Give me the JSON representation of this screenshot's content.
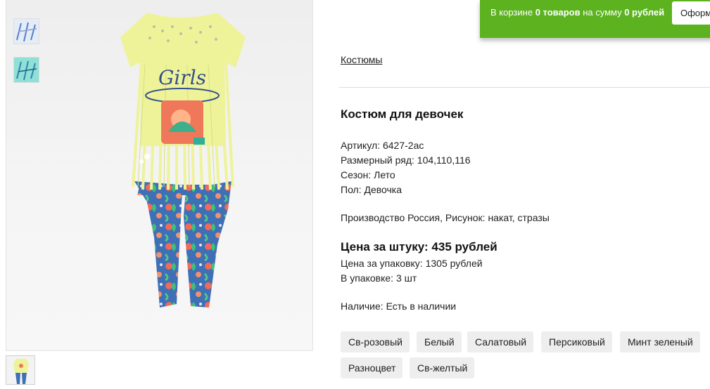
{
  "cart": {
    "prefix": "В корзине ",
    "count": "0 товаров",
    "middle": " на сумму ",
    "sum": "0 рублей",
    "checkout_label": "Оформить"
  },
  "breadcrumb": "Костюмы",
  "product": {
    "title": "Костюм для девочек",
    "props": [
      "Артикул: 6427-2ас",
      "Размерный ряд: 104,110,116",
      "Сезон: Лето",
      "Пол: Девочка"
    ],
    "origin": "Производство Россия, Рисунок: накат, стразы",
    "price_piece": "Цена за штуку: 435 рублей",
    "price_pack": "Цена за упаковку: 1305 рублей",
    "pack_count": "В упаковке: 3 шт",
    "stock": "Наличие: Есть в наличии",
    "print_text": "Girls"
  },
  "colors": [
    "Св-розовый",
    "Белый",
    "Салатовый",
    "Персиковый",
    "Минт зеленый",
    "Разноцвет",
    "Св-желтый"
  ],
  "theme": {
    "cart_green": "#5cb31f",
    "chip_bg": "#eeeeee",
    "shirt": "#eef39a",
    "leggings": "#3f6fb5"
  }
}
